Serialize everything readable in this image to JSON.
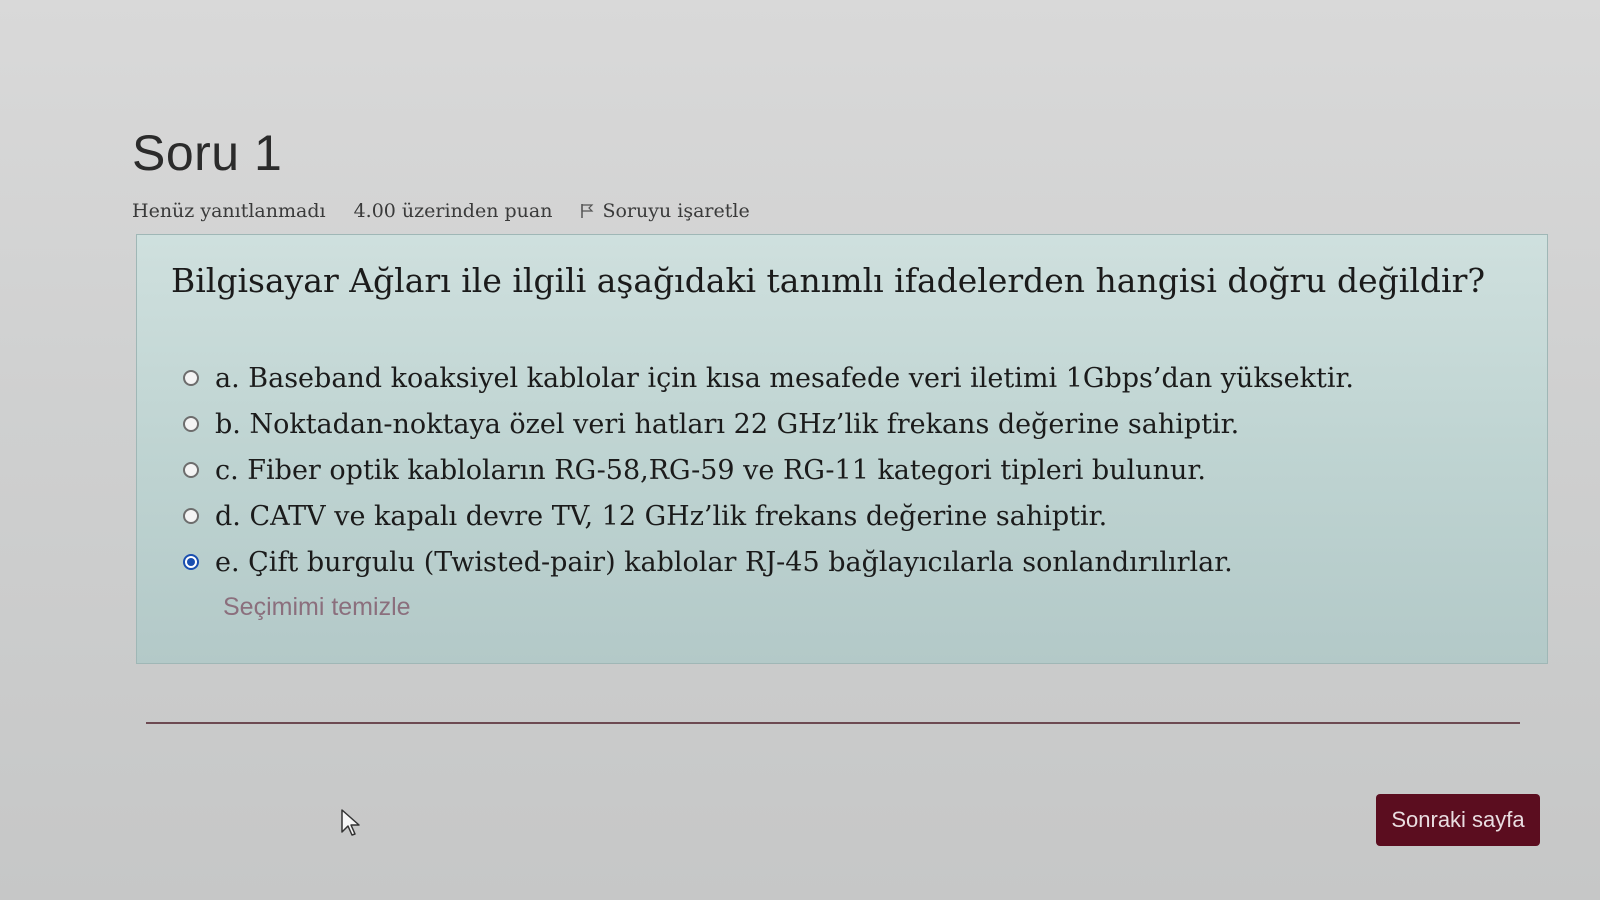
{
  "question": {
    "title": "Soru 1",
    "status": "Henüz yanıtlanmadı",
    "points": "4.00 üzerinden puan",
    "flag_label": "Soruyu işaretle",
    "flag_icon": "flag-icon",
    "text": "Bilgisayar Ağları ile ilgili aşağıdaki tanımlı ifadelerden hangisi doğru değildir?",
    "answers": [
      {
        "label": "a. Baseband koaksiyel kablolar için kısa mesafede veri iletimi 1Gbps’dan yüksektir.",
        "selected": false
      },
      {
        "label": "b. Noktadan-noktaya özel veri hatları 22 GHz’lik frekans değerine sahiptir.",
        "selected": false
      },
      {
        "label": "c. Fiber optik kabloların RG-58,RG-59 ve RG-11 kategori tipleri bulunur.",
        "selected": false
      },
      {
        "label": "d. CATV ve kapalı devre TV, 12 GHz’lik frekans değerine sahiptir.",
        "selected": false
      },
      {
        "label": "e. Çift burgulu (Twisted-pair) kablolar RJ-45 bağlayıcılarla sonlandırılırlar.",
        "selected": true
      }
    ],
    "clear_label": "Seçimimi temizle"
  },
  "navigation": {
    "next_label": "Sonraki sayfa"
  },
  "colors": {
    "question_box": "#bfd4d2",
    "next_button": "#5b0d1f",
    "radio_selected": "#1a4fb0",
    "clear_link": "#8b6f7d"
  }
}
